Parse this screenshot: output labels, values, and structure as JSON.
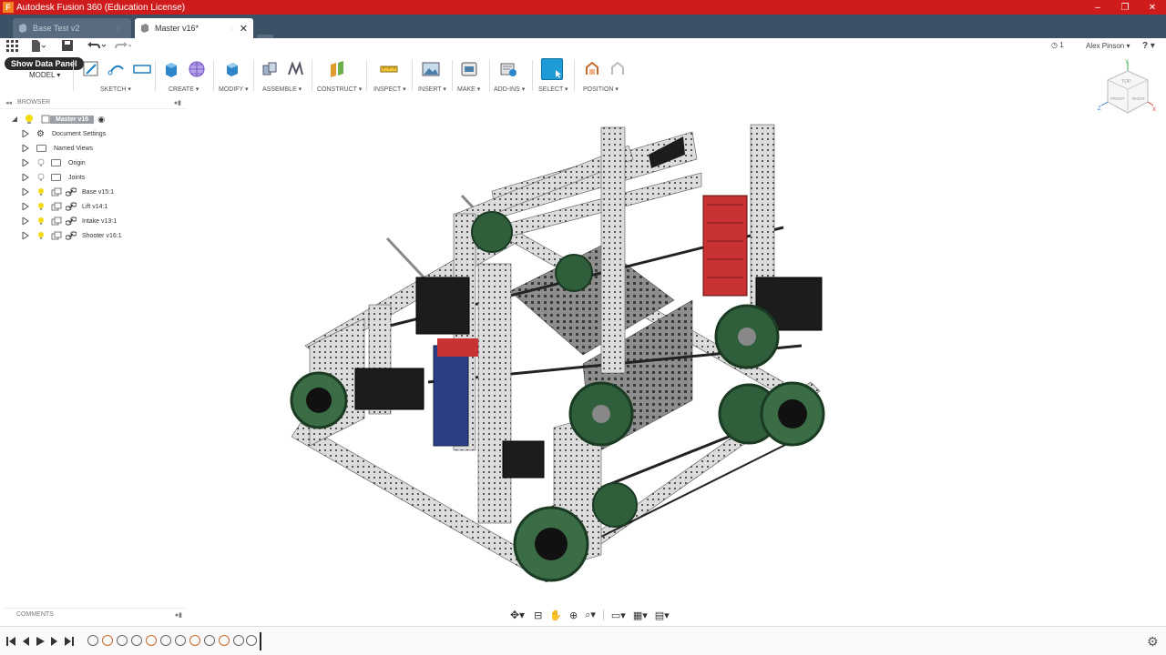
{
  "window": {
    "title": "Autodesk Fusion 360 (Education License)",
    "app_icon_letter": "F",
    "controls": [
      "–",
      "❐",
      "✕"
    ]
  },
  "tabs": [
    {
      "label": "Base Test v2",
      "active": false
    },
    {
      "label": "Master v16*",
      "active": true
    }
  ],
  "new_tab_label": "+",
  "toolbar": {
    "show_data_panel": "Show Data Panel",
    "workspace": "MODEL ▾",
    "groups": [
      {
        "label": "SKETCH ▾"
      },
      {
        "label": "CREATE ▾"
      },
      {
        "label": "MODIFY ▾"
      },
      {
        "label": "ASSEMBLE ▾"
      },
      {
        "label": "CONSTRUCT ▾"
      },
      {
        "label": "INSPECT ▾"
      },
      {
        "label": "INSERT ▾"
      },
      {
        "label": "MAKE ▾"
      },
      {
        "label": "ADD-INS ▾"
      },
      {
        "label": "SELECT ▾"
      },
      {
        "label": "POSITION ▾"
      }
    ],
    "job_count": "1",
    "user_name": "Alex Pinson ▾",
    "help": "? ▾"
  },
  "browser": {
    "title": "BROWSER",
    "root": "Master v16",
    "items": [
      {
        "label": "Document Settings"
      },
      {
        "label": "Named Views"
      },
      {
        "label": "Origin"
      },
      {
        "label": "Joints"
      },
      {
        "label": "Base v15:1"
      },
      {
        "label": "Lift v14:1"
      },
      {
        "label": "Intake v13:1"
      },
      {
        "label": "Shooter v16:1"
      }
    ]
  },
  "comments": {
    "title": "COMMENTS"
  },
  "viewcube": {
    "top": "TOP",
    "front": "FRONT",
    "right": "RIGHT",
    "x": "X",
    "y": "Y",
    "z": "Z"
  },
  "colors": {
    "title_bar": "#cf1b1b",
    "tab_bar": "#3c5066",
    "select_blue": "#1e9bd7",
    "robot_metal": "#d9d9d9",
    "wheel_green": "#2e5e3a"
  }
}
